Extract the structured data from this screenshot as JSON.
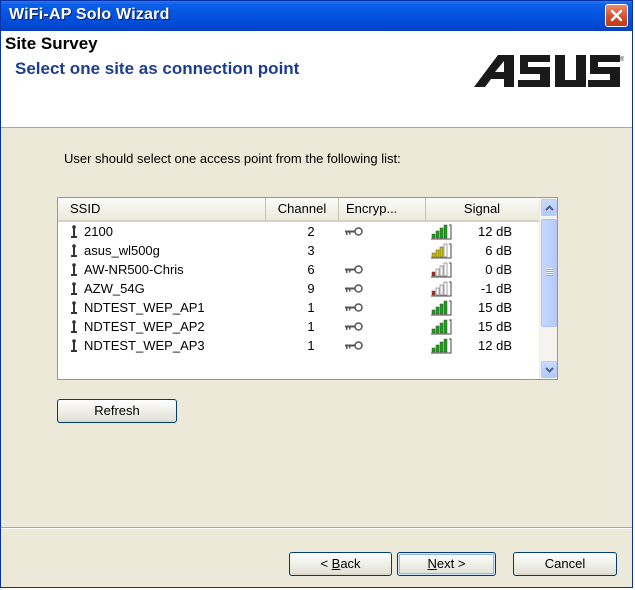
{
  "window": {
    "title": "WiFi-AP Solo Wizard",
    "close_icon": "close-icon",
    "accent_color": "#0553df"
  },
  "header": {
    "title": "Site Survey",
    "subtitle": "Select one site as connection point",
    "logo_text": "ASUS"
  },
  "instruction": "User should select one access point from the following list:",
  "list": {
    "columns": {
      "ssid": "SSID",
      "channel": "Channel",
      "encryption": "Encryp...",
      "signal": "Signal"
    },
    "rows": [
      {
        "ssid": "2100",
        "channel": "2",
        "encrypted": true,
        "signal": "12 dB",
        "level": "green"
      },
      {
        "ssid": "asus_wl500g",
        "channel": "3",
        "encrypted": false,
        "signal": "6 dB",
        "level": "yellow"
      },
      {
        "ssid": "AW-NR500-Chris",
        "channel": "6",
        "encrypted": true,
        "signal": "0 dB",
        "level": "red"
      },
      {
        "ssid": "AZW_54G",
        "channel": "9",
        "encrypted": true,
        "signal": "-1 dB",
        "level": "red"
      },
      {
        "ssid": "NDTEST_WEP_AP1",
        "channel": "1",
        "encrypted": true,
        "signal": "15 dB",
        "level": "green"
      },
      {
        "ssid": "NDTEST_WEP_AP2",
        "channel": "1",
        "encrypted": true,
        "signal": "15 dB",
        "level": "green"
      },
      {
        "ssid": "NDTEST_WEP_AP3",
        "channel": "1",
        "encrypted": true,
        "signal": "12 dB",
        "level": "green"
      }
    ]
  },
  "buttons": {
    "refresh": "Refresh",
    "back_mnemonic": "B",
    "back_rest": "ack",
    "back_prefix": "< ",
    "next_mnemonic": "N",
    "next_rest": "ext >",
    "cancel": "Cancel"
  }
}
